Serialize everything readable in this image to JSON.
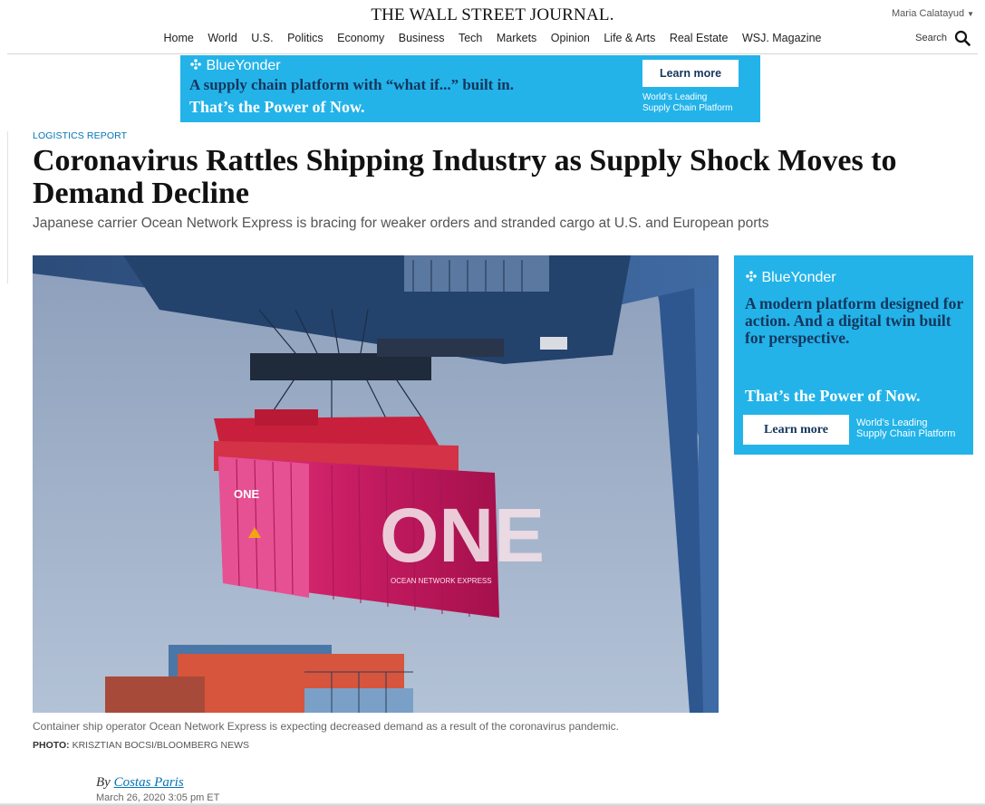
{
  "header": {
    "logo": "THE WALL STREET JOURNAL.",
    "user": "Maria Calatayud",
    "search_label": "Search",
    "nav": [
      "Home",
      "World",
      "U.S.",
      "Politics",
      "Economy",
      "Business",
      "Tech",
      "Markets",
      "Opinion",
      "Life & Arts",
      "Real Estate",
      "WSJ. Magazine"
    ]
  },
  "ad_top": {
    "brand": "BlueYonder",
    "line1": "A supply chain platform with “what if...” built in.",
    "line2": "That’s the Power of Now.",
    "button": "Learn more",
    "tag1": "World’s Leading",
    "tag2": "Supply Chain Platform"
  },
  "article": {
    "kicker": "LOGISTICS REPORT",
    "headline": "Coronavirus Rattles Shipping Industry as Supply Shock Moves to Demand Decline",
    "dek": "Japanese carrier Ocean Network Express is bracing for weaker orders and stranded cargo at U.S. and European ports",
    "caption": "Container ship operator Ocean Network Express is expecting decreased demand as a result of the coronavirus pandemic.",
    "credit_label": "PHOTO:",
    "credit": "KRISZTIAN BOCSI/BLOOMBERG NEWS",
    "by": "By",
    "author": "Costas Paris",
    "date": "March 26, 2020 3:05 pm ET",
    "container_text": "ONE",
    "container_small_text": "ONE",
    "container_side_text": "OCEAN NETWORK EXPRESS"
  },
  "ad_side": {
    "brand": "BlueYonder",
    "copy": "A modern platform designed for action. And a digital twin built for perspective.",
    "power": "That’s the Power of Now.",
    "button": "Learn more",
    "tag1": "World’s Leading",
    "tag2": "Supply Chain Platform"
  },
  "colors": {
    "accent_blue": "#0274b6",
    "ad_blue": "#23b3e9",
    "ad_navy": "#14365d",
    "container_magenta": "#d4266e"
  },
  "icons": [
    "caret-down-icon",
    "search-icon",
    "blueyonder-logo-icon"
  ]
}
